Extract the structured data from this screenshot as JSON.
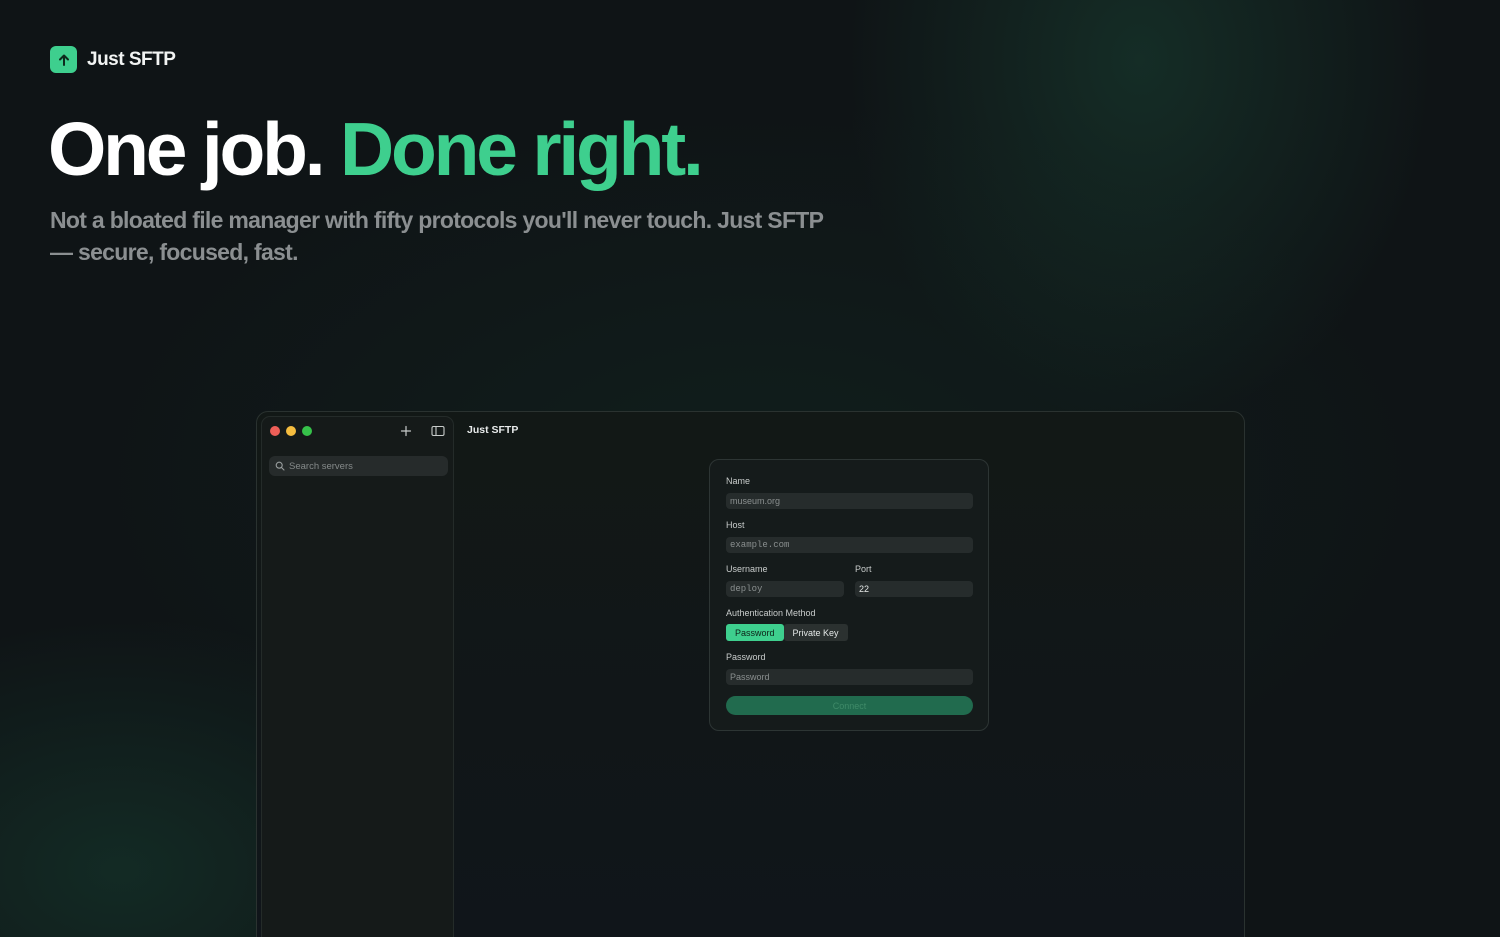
{
  "brand": {
    "name": "Just SFTP",
    "icon": "arrow-up-icon",
    "color": "#3ecf8e"
  },
  "hero": {
    "title_main": "One job.",
    "title_accent": "Done right.",
    "subtitle": "Not a bloated file manager with fifty protocols you'll never touch. Just SFTP — secure, focused, fast."
  },
  "app": {
    "window_title": "Just SFTP",
    "sidebar": {
      "search_placeholder": "Search servers",
      "add_icon": "plus-icon",
      "toggle_icon": "sidebar-toggle-icon"
    },
    "form": {
      "name_label": "Name",
      "name_placeholder": "museum.org",
      "host_label": "Host",
      "host_placeholder": "example.com",
      "username_label": "Username",
      "username_placeholder": "deploy",
      "port_label": "Port",
      "port_value": "22",
      "auth_label": "Authentication Method",
      "auth_options": [
        "Password",
        "Private Key"
      ],
      "auth_selected": "Password",
      "password_label": "Password",
      "password_placeholder": "Password",
      "connect_label": "Connect"
    }
  }
}
